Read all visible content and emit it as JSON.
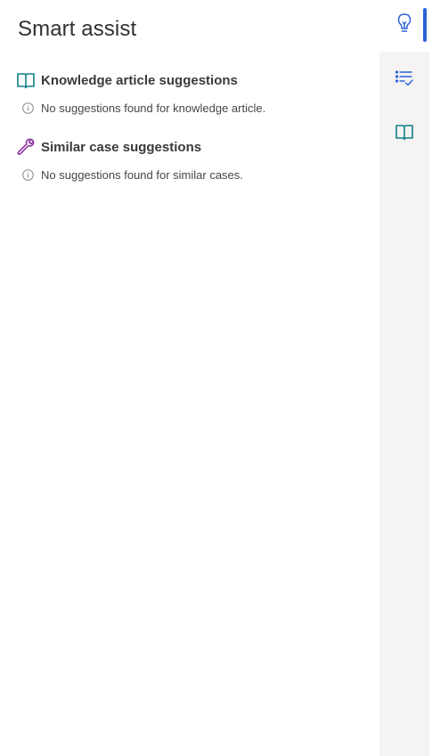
{
  "panel": {
    "title": "Smart assist"
  },
  "sections": [
    {
      "title": "Knowledge article suggestions",
      "icon": "book-icon",
      "empty_message": "No suggestions found for knowledge article."
    },
    {
      "title": "Similar case suggestions",
      "icon": "wrench-icon",
      "empty_message": "No suggestions found for similar cases."
    }
  ],
  "rail": {
    "items": [
      {
        "icon": "lightbulb-icon",
        "selected": true
      },
      {
        "icon": "checklist-icon",
        "selected": false
      },
      {
        "icon": "book-icon",
        "selected": false
      }
    ]
  },
  "colors": {
    "accent_blue": "#2b63d9",
    "book_teal": "#0f7f86",
    "wrench_purple": "#8a2f9e",
    "rail_background": "#f5f4f3"
  }
}
